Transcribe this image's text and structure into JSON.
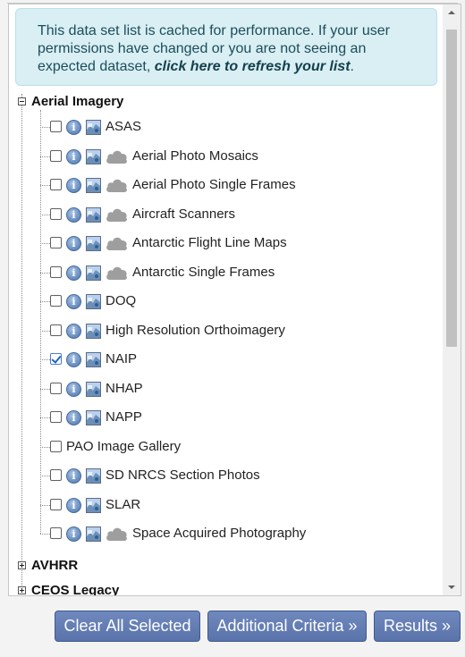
{
  "notice": {
    "text": "This data set list is cached for performance. If your user permissions have changed or you are not seeing an expected dataset, ",
    "link": "click here to refresh your list",
    "suffix": "."
  },
  "tree": {
    "categories": [
      {
        "label": "Aerial Imagery",
        "expanded": true
      },
      {
        "label": "AVHRR",
        "expanded": false
      },
      {
        "label": "CEOS Legacy",
        "expanded": false
      }
    ],
    "datasets": [
      {
        "label": "ASAS",
        "checked": false,
        "cloud": false
      },
      {
        "label": "Aerial Photo Mosaics",
        "checked": false,
        "cloud": true
      },
      {
        "label": "Aerial Photo Single Frames",
        "checked": false,
        "cloud": true
      },
      {
        "label": "Aircraft Scanners",
        "checked": false,
        "cloud": true
      },
      {
        "label": "Antarctic Flight Line Maps",
        "checked": false,
        "cloud": true
      },
      {
        "label": "Antarctic Single Frames",
        "checked": false,
        "cloud": true
      },
      {
        "label": "DOQ",
        "checked": false,
        "cloud": false
      },
      {
        "label": "High Resolution Orthoimagery",
        "checked": false,
        "cloud": false
      },
      {
        "label": "NAIP",
        "checked": true,
        "cloud": false
      },
      {
        "label": "NHAP",
        "checked": false,
        "cloud": false
      },
      {
        "label": "NAPP",
        "checked": false,
        "cloud": false
      },
      {
        "label": "PAO Image Gallery",
        "checked": false,
        "cloud": false,
        "icons": false
      },
      {
        "label": "SD NRCS Section Photos",
        "checked": false,
        "cloud": false
      },
      {
        "label": "SLAR",
        "checked": false,
        "cloud": false
      },
      {
        "label": "Space Acquired Photography",
        "checked": false,
        "cloud": true
      }
    ],
    "icons": {
      "info": "info-icon",
      "info_glyph": "i",
      "map": "map-preview-icon",
      "cloud": "cloud-icon"
    }
  },
  "buttons": {
    "clear": "Clear All Selected",
    "additional": "Additional Criteria »",
    "results": "Results »"
  },
  "colors": {
    "notice_bg": "#d9eff4",
    "button_bg": "#6a82b8",
    "checkbox_check": "#1a64c9"
  }
}
